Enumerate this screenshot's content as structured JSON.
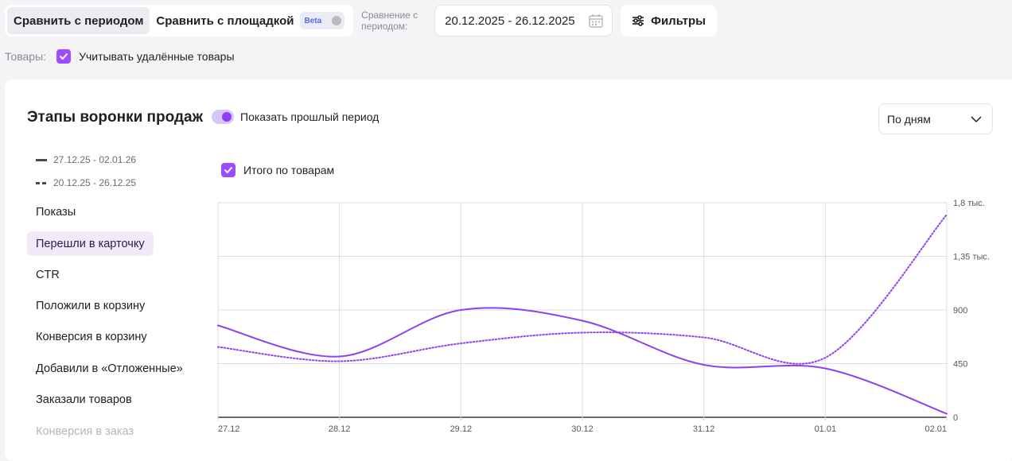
{
  "toolbar": {
    "compare_period": "Сравнить с периодом",
    "compare_platform": "Сравнить с площадкой",
    "beta": "Beta",
    "compare_label": "Сравнение с периодом:",
    "date_range": "20.12.2025 - 26.12.2025",
    "filters": "Фильтры"
  },
  "goods": {
    "label": "Товары:",
    "include_deleted": "Учитывать удалённые товары"
  },
  "card": {
    "title": "Этапы воронки продаж",
    "show_prev": "Показать прошлый период",
    "granularity": "По дням",
    "total_checkbox": "Итого по товарам"
  },
  "legend": {
    "current": "27.12.25 - 02.01.26",
    "previous": "20.12.25 - 26.12.25"
  },
  "metrics": [
    "Показы",
    "Перешли в карточку",
    "CTR",
    "Положили в корзину",
    "Конверсия в корзину",
    "Добавили в «Отложенные»",
    "Заказали товаров",
    "Конверсия в заказ"
  ],
  "colors": {
    "accent": "#9b4dff",
    "line": "#8f3ff5"
  },
  "chart_data": {
    "type": "line",
    "categories": [
      "27.12",
      "28.12",
      "29.12",
      "30.12",
      "31.12",
      "01.01",
      "02.01"
    ],
    "y_ticks": [
      0,
      450,
      900,
      1350,
      1800
    ],
    "y_tick_labels": [
      "0",
      "450",
      "900",
      "1,35 тыс.",
      "1,8 тыс."
    ],
    "ylim": [
      0,
      1800
    ],
    "grid": true,
    "series": [
      {
        "name": "27.12.25 - 02.01.26",
        "style": "solid",
        "values": [
          770,
          510,
          900,
          810,
          440,
          410,
          30
        ]
      },
      {
        "name": "20.12.25 - 26.12.25",
        "style": "dotted",
        "values": [
          590,
          470,
          620,
          710,
          670,
          500,
          1700
        ]
      }
    ]
  }
}
